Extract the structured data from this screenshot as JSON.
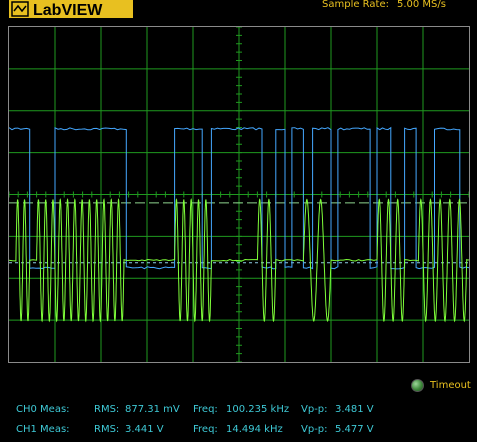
{
  "header": {
    "logo_text": "LabVIEW",
    "sample_rate_label": "Sample Rate:",
    "sample_rate_value": "5.00 MS/s"
  },
  "status": {
    "timeout_label": "Timeout"
  },
  "measurements": [
    {
      "channel_label": "CH0 Meas:",
      "rms_label": "RMS:",
      "rms_value": "877.31 mV",
      "freq_label": "Freq:",
      "freq_value": "100.235 kHz",
      "vpp_label": "Vp-p:",
      "vpp_value": "3.481 V"
    },
    {
      "channel_label": "CH1 Meas:",
      "rms_label": "RMS:",
      "rms_value": "3.441 V",
      "freq_label": "Freq:",
      "freq_value": "14.494 kHz",
      "vpp_label": "Vp-p:",
      "vpp_value": "5.477 V"
    }
  ],
  "colors": {
    "background": "#000000",
    "grid": "#1f9a1f",
    "ch0_trace": "#45a8ff",
    "ch1_trace": "#7fff3a",
    "ch0_reference": "#8fcde6",
    "ch1_reference": "#8fd68f",
    "accent_text": "#e8c020",
    "meas_text": "#3ec9d6",
    "led": "#4f9e4a"
  },
  "chart_data": {
    "type": "line",
    "grid": true,
    "x_divisions": 10,
    "y_divisions": 8,
    "series": [
      {
        "high_level": 2.43,
        "low_level": 5.75,
        "reference_level": 5.63,
        "color": "#45a8ff",
        "levels": [
          1,
          0,
          1,
          0,
          1,
          0,
          1,
          0,
          1,
          0,
          1,
          0,
          1,
          0,
          1,
          0,
          1,
          0,
          1,
          0,
          1,
          0,
          1
        ],
        "edges": [
          0.0,
          0.045,
          0.1,
          0.255,
          0.36,
          0.42,
          0.44,
          0.55,
          0.58,
          0.6,
          0.615,
          0.64,
          0.66,
          0.7,
          0.715,
          0.785,
          0.8,
          0.83,
          0.86,
          0.885,
          0.925,
          0.98,
          1.0
        ]
      },
      {
        "center_level": 5.57,
        "amplitude": 1.45,
        "reference_level": 4.2,
        "color": "#7fff3a",
        "bursts": [
          {
            "start": 0.015,
            "end": 0.045,
            "cycles": 2
          },
          {
            "start": 0.06,
            "end": 0.25,
            "cycles": 12
          },
          {
            "start": 0.36,
            "end": 0.44,
            "cycles": 5
          },
          {
            "start": 0.54,
            "end": 0.58,
            "cycles": 2
          },
          {
            "start": 0.64,
            "end": 0.7,
            "cycles": 2
          },
          {
            "start": 0.8,
            "end": 0.86,
            "cycles": 3
          },
          {
            "start": 0.89,
            "end": 0.995,
            "cycles": 5
          }
        ]
      }
    ]
  }
}
